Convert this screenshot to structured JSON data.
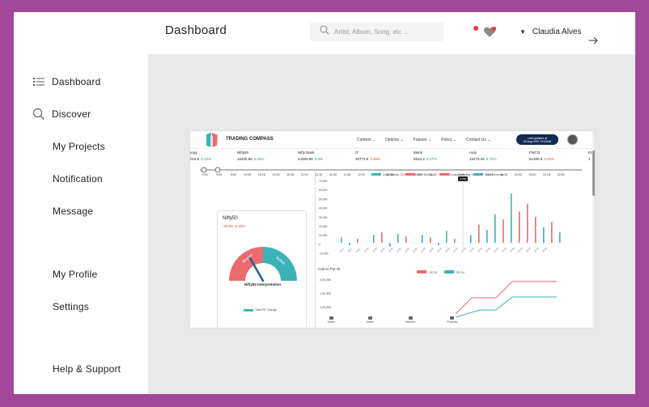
{
  "sidebar": {
    "items": [
      {
        "label": "Dashboard",
        "icon": "list-icon"
      },
      {
        "label": "Discover",
        "icon": "search-icon"
      },
      {
        "label": "My Projects"
      },
      {
        "label": "Notification"
      },
      {
        "label": "Message"
      },
      {
        "label": "My Profile"
      },
      {
        "label": "Settings"
      },
      {
        "label": "Help & Support"
      }
    ]
  },
  "header": {
    "title": "Dashboard",
    "search_placeholder": "Artist, Album, Song, etc ...",
    "user_name": "Claudia Alves"
  },
  "screenshot": {
    "brand": "TRADING COMPASS",
    "nav": [
      "Contest",
      "Options",
      "Futures",
      "Policy",
      "Contact Us"
    ],
    "pill_line1": "Last updated at",
    "pill_line2": "30 Aug 2022 10:00AM",
    "tickers": [
      {
        "name": "ergy",
        "value": "015.8",
        "change": "0.13%",
        "neg": false
      },
      {
        "name": "Nifty50",
        "value": "16306.85",
        "change": "0.23%",
        "neg": false
      },
      {
        "name": "Nifty Bank",
        "value": "44484.85",
        "change": "0.8%",
        "neg": false
      },
      {
        "name": "IT",
        "value": "30773.6",
        "change": "0.46%",
        "neg": true
      },
      {
        "name": "Metal",
        "value": "6533.3",
        "change": "0.27%",
        "neg": false
      },
      {
        "name": "Auto",
        "value": "15475.25",
        "change": "0.72%",
        "neg": false
      },
      {
        "name": "FMCG",
        "value": "51380.8",
        "change": "0.03%",
        "neg": true
      },
      {
        "name": "En",
        "value": "1",
        "change": "",
        "neg": false
      }
    ],
    "times": [
      "9:15",
      "9:30",
      "9:45",
      "10:00",
      "10:15",
      "10:30",
      "10:45",
      "11:00",
      "11:15",
      "11:30",
      "11:45",
      "12:00",
      "12:15",
      "12:30",
      "12:45",
      "13:00",
      "13:15",
      "13:30",
      "13:45",
      "14:00",
      "14:15",
      "14:30",
      "14:45",
      "15:00",
      "15:15",
      "15:30"
    ],
    "panel_title": "Nifty50",
    "panel_change": "-29.65 -0.15%",
    "gauge_left": "Bearish",
    "gauge_right": "Bullish",
    "gauge_caption": "Nifty50 Interpretation",
    "panel_legend": "Total PE Change",
    "bar_legend": [
      "Long Buildup",
      "Short Buildup",
      "Long Unwinding",
      "Short Covering"
    ],
    "bar_yticks": [
      "70,000",
      "60,000",
      "50,000",
      "40,000",
      "30,000",
      "20,000",
      "10,000",
      "0",
      "-10,000"
    ],
    "bar_marker": "4.7M",
    "callput_title": "Call vs Put OI",
    "callput_legend": [
      "CE OI",
      "PE OI"
    ],
    "callput_yticks": [
      "2,00,000",
      "1,50,000",
      "1,00,000"
    ],
    "bottom_nav": [
      "Home",
      "Index",
      "Sectors",
      "Portfolio"
    ]
  },
  "colors": {
    "frame": "#a3479a",
    "teal": "#3bb2b8",
    "red": "#ec6b6b",
    "navy": "#122a52"
  }
}
